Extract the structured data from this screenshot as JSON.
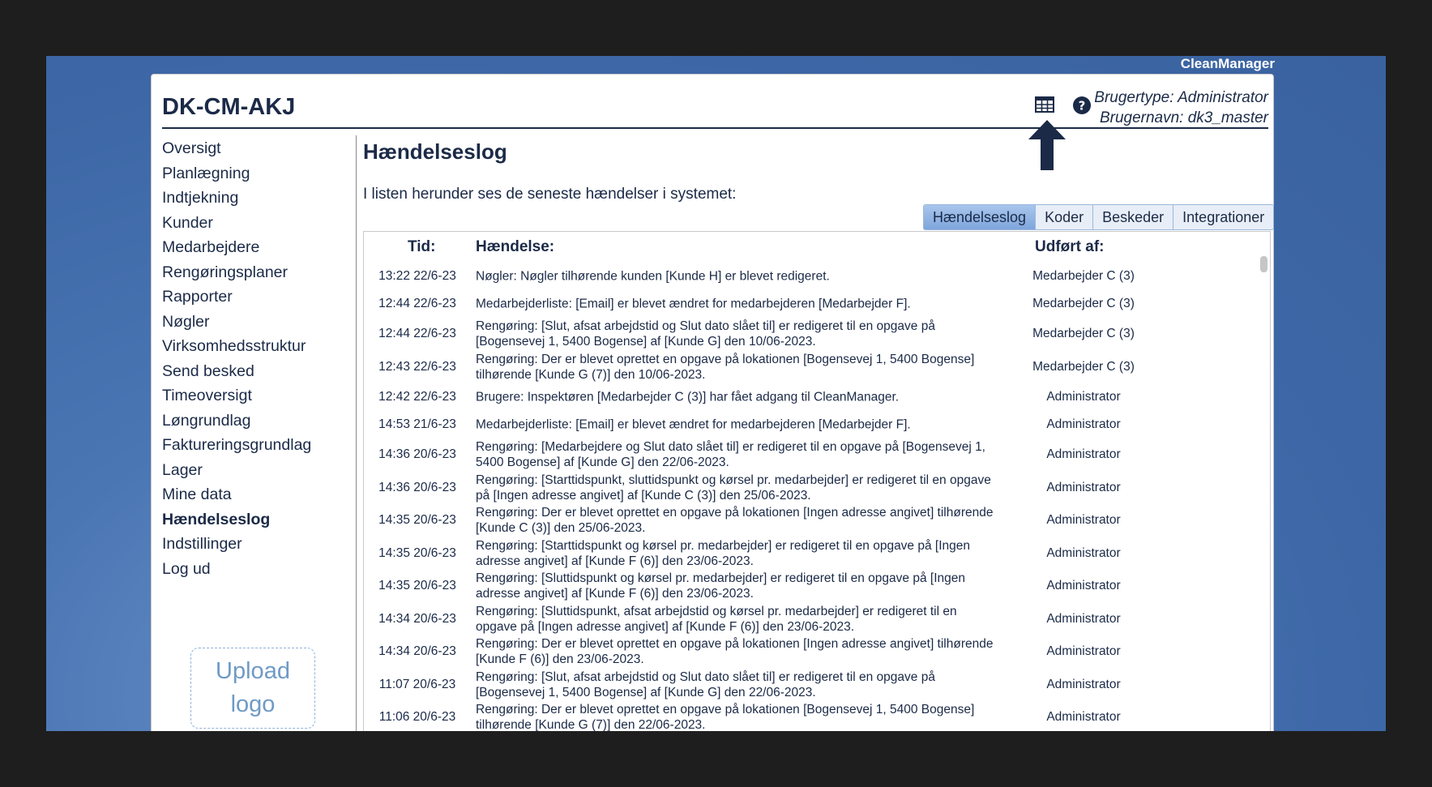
{
  "app": {
    "brand": "CleanManager",
    "site_title": "DK-CM-AKJ"
  },
  "user": {
    "type": "Brugertype: Administrator",
    "name": "Brugernavn: dk3_master"
  },
  "icons": {
    "table": "table-grid-icon",
    "help": "help-circle-icon",
    "arrow": "arrow-up-icon"
  },
  "colors": {
    "text": "#1b2a47",
    "desktop": "#4a76b4",
    "tab_active": "#8fb0e0",
    "upload_border": "#8fb2d6"
  },
  "sidebar": {
    "items": [
      {
        "label": "Oversigt",
        "key": "oversigt"
      },
      {
        "label": "Planlægning",
        "key": "planlaegning"
      },
      {
        "label": "Indtjekning",
        "key": "indtjekning"
      },
      {
        "label": "Kunder",
        "key": "kunder"
      },
      {
        "label": "Medarbejdere",
        "key": "medarbejdere"
      },
      {
        "label": "Rengøringsplaner",
        "key": "rengoringsplaner"
      },
      {
        "label": "Rapporter",
        "key": "rapporter"
      },
      {
        "label": "Nøgler",
        "key": "nogler"
      },
      {
        "label": "Virksomhedsstruktur",
        "key": "virksomhedsstruktur"
      },
      {
        "label": "Send besked",
        "key": "send-besked"
      },
      {
        "label": "Timeoversigt",
        "key": "timeoversigt"
      },
      {
        "label": "Løngrundlag",
        "key": "longrundlag"
      },
      {
        "label": "Faktureringsgrundlag",
        "key": "faktureringsgrundlag"
      },
      {
        "label": "Lager",
        "key": "lager"
      },
      {
        "label": "Mine data",
        "key": "mine-data"
      },
      {
        "label": "Hændelseslog",
        "key": "haendelseslog",
        "active": true
      },
      {
        "label": "Indstillinger",
        "key": "indstillinger"
      },
      {
        "label": "Log ud",
        "key": "log-ud"
      }
    ],
    "upload_logo": {
      "line1": "Upload",
      "line2": "logo"
    }
  },
  "main": {
    "heading": "Hændelseslog",
    "intro": "I listen herunder ses de seneste hændelser i systemet:",
    "tabs": [
      {
        "label": "Hændelseslog",
        "active": true
      },
      {
        "label": "Koder"
      },
      {
        "label": "Beskeder"
      },
      {
        "label": "Integrationer"
      }
    ],
    "columns": {
      "time": "Tid:",
      "event": "Hændelse:",
      "by": "Udført af:"
    },
    "rows": [
      {
        "time": "13:22 22/6-23",
        "event": "Nøgler: Nøgler tilhørende kunden [Kunde H] er blevet redigeret.",
        "by": "Medarbejder C (3)"
      },
      {
        "time": "12:44 22/6-23",
        "event": "Medarbejderliste: [Email] er blevet ændret for medarbejderen [Medarbejder F].",
        "by": "Medarbejder C (3)"
      },
      {
        "time": "12:44 22/6-23",
        "event": "Rengøring: [Slut, afsat arbejdstid og Slut dato slået til] er redigeret til en opgave på [Bogensevej 1, 5400 Bogense] af [Kunde G] den 10/06-2023.",
        "by": "Medarbejder C (3)"
      },
      {
        "time": "12:43 22/6-23",
        "event": "Rengøring: Der er blevet oprettet en opgave på lokationen [Bogensevej 1, 5400 Bogense] tilhørende [Kunde G (7)] den 10/06-2023.",
        "by": "Medarbejder C (3)"
      },
      {
        "time": "12:42 22/6-23",
        "event": "Brugere: Inspektøren [Medarbejder C (3)] har fået adgang til CleanManager.",
        "by": "Administrator"
      },
      {
        "time": "14:53 21/6-23",
        "event": "Medarbejderliste: [Email] er blevet ændret for medarbejderen [Medarbejder F].",
        "by": "Administrator"
      },
      {
        "time": "14:36 20/6-23",
        "event": "Rengøring: [Medarbejdere og Slut dato slået til] er redigeret til en opgave på [Bogensevej 1, 5400 Bogense] af [Kunde G] den 22/06-2023.",
        "by": "Administrator"
      },
      {
        "time": "14:36 20/6-23",
        "event": "Rengøring: [Starttidspunkt, sluttidspunkt og kørsel pr. medarbejder] er redigeret til en opgave på [Ingen adresse angivet] af [Kunde C (3)] den 25/06-2023.",
        "by": "Administrator"
      },
      {
        "time": "14:35 20/6-23",
        "event": "Rengøring: Der er blevet oprettet en opgave på lokationen [Ingen adresse angivet] tilhørende [Kunde C (3)] den 25/06-2023.",
        "by": "Administrator"
      },
      {
        "time": "14:35 20/6-23",
        "event": "Rengøring: [Starttidspunkt og kørsel pr. medarbejder] er redigeret til en opgave på [Ingen adresse angivet] af [Kunde F (6)] den 23/06-2023.",
        "by": "Administrator"
      },
      {
        "time": "14:35 20/6-23",
        "event": "Rengøring: [Sluttidspunkt og kørsel pr. medarbejder] er redigeret til en opgave på [Ingen adresse angivet] af [Kunde F (6)] den 23/06-2023.",
        "by": "Administrator"
      },
      {
        "time": "14:34 20/6-23",
        "event": "Rengøring: [Sluttidspunkt, afsat arbejdstid og kørsel pr. medarbejder] er redigeret til en opgave på [Ingen adresse angivet] af [Kunde F (6)] den 23/06-2023.",
        "by": "Administrator"
      },
      {
        "time": "14:34 20/6-23",
        "event": "Rengøring: Der er blevet oprettet en opgave på lokationen [Ingen adresse angivet] tilhørende [Kunde F (6)] den 23/06-2023.",
        "by": "Administrator"
      },
      {
        "time": "11:07 20/6-23",
        "event": "Rengøring: [Slut, afsat arbejdstid og Slut dato slået til] er redigeret til en opgave på [Bogensevej 1, 5400 Bogense] af [Kunde G] den 22/06-2023.",
        "by": "Administrator"
      },
      {
        "time": "11:06 20/6-23",
        "event": "Rengøring: Der er blevet oprettet en opgave på lokationen [Bogensevej 1, 5400 Bogense] tilhørende [Kunde G (7)] den 22/06-2023.",
        "by": "Administrator"
      }
    ]
  }
}
